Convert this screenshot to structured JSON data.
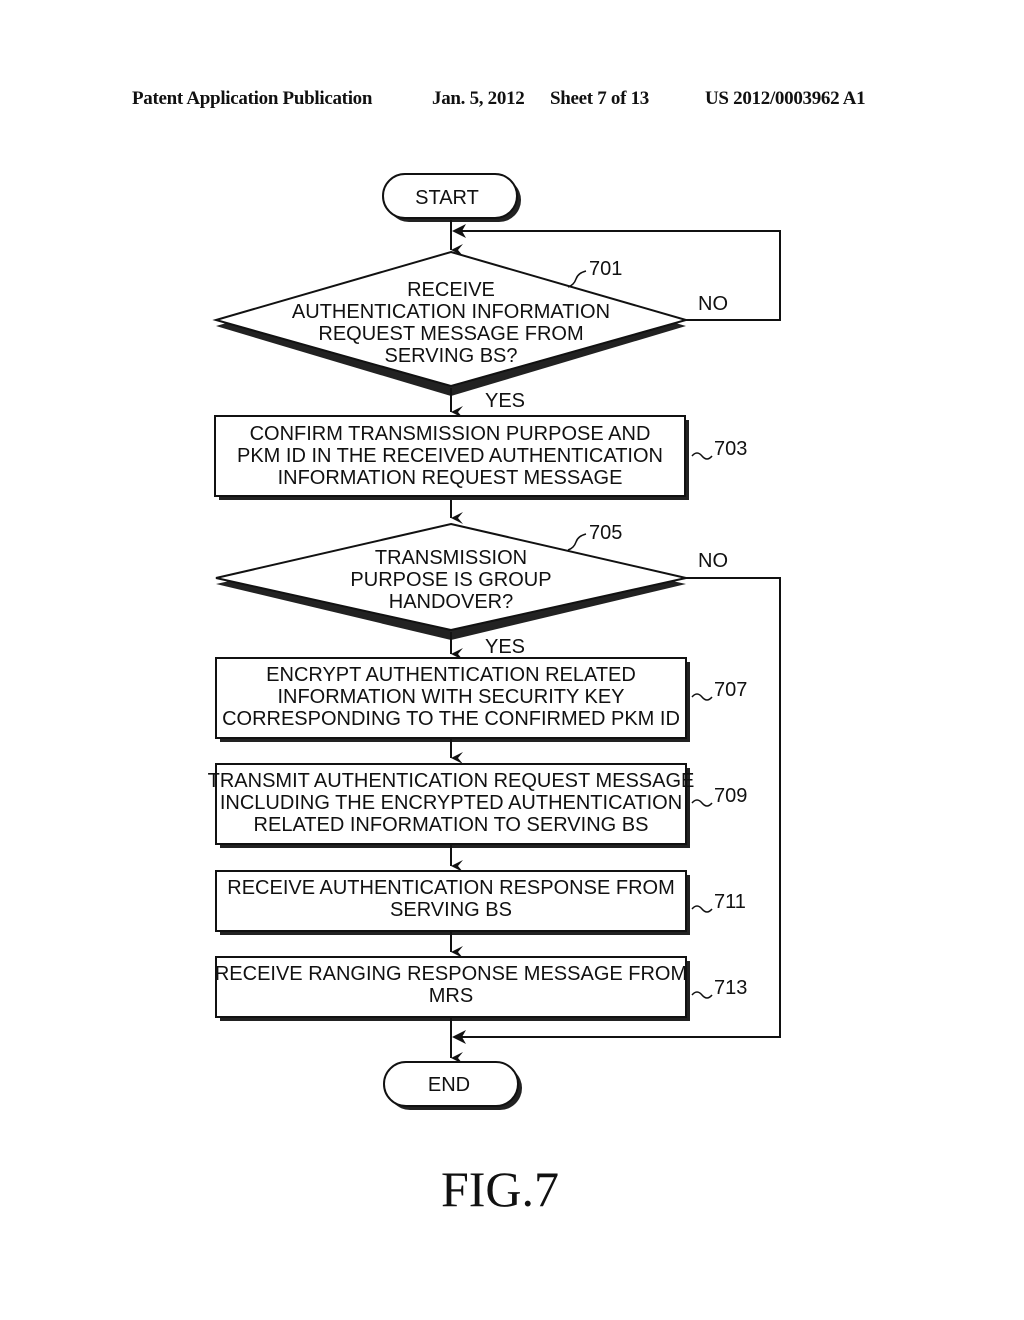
{
  "header": {
    "publication": "Patent Application Publication",
    "date": "Jan. 5, 2012",
    "sheet": "Sheet 7 of 13",
    "number": "US 2012/0003962 A1"
  },
  "flowchart": {
    "start": "START",
    "end": "END",
    "yes_label": "YES",
    "no_label": "NO",
    "steps": {
      "s701": {
        "ref": "701",
        "type": "decision",
        "lines": [
          "RECEIVE",
          "AUTHENTICATION INFORMATION",
          "REQUEST MESSAGE FROM",
          "SERVING BS?"
        ]
      },
      "s703": {
        "ref": "703",
        "type": "process",
        "lines": [
          "CONFIRM TRANSMISSION PURPOSE AND",
          "PKM ID IN THE RECEIVED AUTHENTICATION",
          "INFORMATION REQUEST MESSAGE"
        ]
      },
      "s705": {
        "ref": "705",
        "type": "decision",
        "lines": [
          "TRANSMISSION",
          "PURPOSE IS GROUP",
          "HANDOVER?"
        ]
      },
      "s707": {
        "ref": "707",
        "type": "process",
        "lines": [
          "ENCRYPT AUTHENTICATION RELATED",
          "INFORMATION WITH SECURITY KEY",
          "CORRESPONDING TO THE CONFIRMED PKM ID"
        ]
      },
      "s709": {
        "ref": "709",
        "type": "process",
        "lines": [
          "TRANSMIT AUTHENTICATION REQUEST MESSAGE",
          "INCLUDING THE ENCRYPTED AUTHENTICATION",
          "RELATED INFORMATION TO SERVING BS"
        ]
      },
      "s711": {
        "ref": "711",
        "type": "process",
        "lines": [
          "RECEIVE AUTHENTICATION RESPONSE FROM",
          "SERVING BS"
        ]
      },
      "s713": {
        "ref": "713",
        "type": "process",
        "lines": [
          "RECEIVE RANGING RESPONSE MESSAGE FROM",
          "MRS"
        ]
      }
    }
  },
  "figure_label": "FIG.7"
}
